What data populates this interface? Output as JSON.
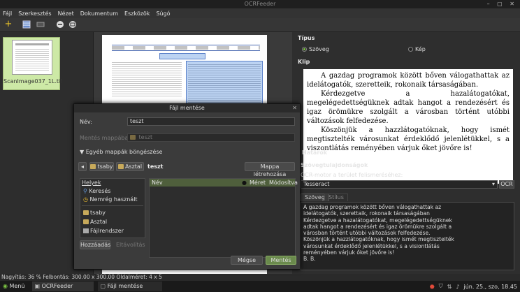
{
  "window": {
    "title": "OCRFeeder",
    "controls": "– ▢ ✕"
  },
  "menu": [
    "Fájl",
    "Szerkesztés",
    "Nézet",
    "Dokumentum",
    "Eszközök",
    "Súgó"
  ],
  "thumbnail": {
    "label": "ScanImage037_1L.tif"
  },
  "right": {
    "type_label": "Típus",
    "radio_text": "Szöveg",
    "radio_image": "Kép",
    "clip_label": "Klip",
    "clip_paragraphs": [
      "A gazdag programok között bőven válogathattak az idelátogatók, szeretteik, rokonaik társaságában.",
      "Kérdezgetve a hazalátogatókat, megelégedettségüknek adtak hangot a rendezésért és igaz örömükre szolgált a városban történt utóbbi változások felfedezése.",
      "Köszönjük a hazzlátogatóknak, hogy ismét megtisztelték városunkat érdeklődő jelenlétükkel, s a viszontlátás reményében várjuk őket jövőre is!"
    ],
    "borders_label": "Határok",
    "text_props_label": "Szövegtulajdonságok",
    "ocr_engine_label": "OCR-motor a terület felismeréséhez:",
    "ocr_engine_value": "Tesseract",
    "ocr_button": "OCR",
    "tab_text": "Szöveg",
    "tab_style": "Stílus",
    "ocr_text": "A gazdag programok között bőven válogathattak az\nidelátogatók, szerettaik, rokonaik társaságában\nKérdezgetve a hazalátogatókat, megelégedettségüknek\nadtak hangot a rendezésért és igaz örömükre szolgált a\nvárosban történt utóbbi változások felfedezése.\nKöszönjük a hazzlátogatóknak, hogy ismét megtisztelték\nvárosunkat érdeklődő jelenlétükkel, s a visiontlátás\nreményében várjuk őket jövőre is!\nB. B."
  },
  "statusbar": "Nagyítás: 36 % Felbontás: 300.00 x 300.00 Oldalméret: 4 x 5",
  "taskbar": {
    "menu": "Menü",
    "task1": "OCRFeeder",
    "task2": "Fájl mentése",
    "clock": "jún. 25., szo, 18.45"
  },
  "dialog": {
    "title": "Fájl mentése",
    "name_label": "Név:",
    "name_value": "teszt",
    "save_in_label": "Mentés mappába:",
    "save_in_value": "teszt",
    "browse_label": "▼ Egyéb mappák böngészése",
    "path": [
      "tsaby",
      "Asztal",
      "teszt"
    ],
    "create_folder": "Mappa létrehozása",
    "places_header": "Helyek",
    "places": [
      "Keresés",
      "Nemrég használt",
      "tsaby",
      "Asztal",
      "Fájlrendszer"
    ],
    "add_button": "Hozzáadás",
    "remove_button": "Eltávolítás",
    "col_name": "Név",
    "col_size": "Méret",
    "col_modified": "Módosítva",
    "cancel": "Mégse",
    "save": "Mentés"
  }
}
